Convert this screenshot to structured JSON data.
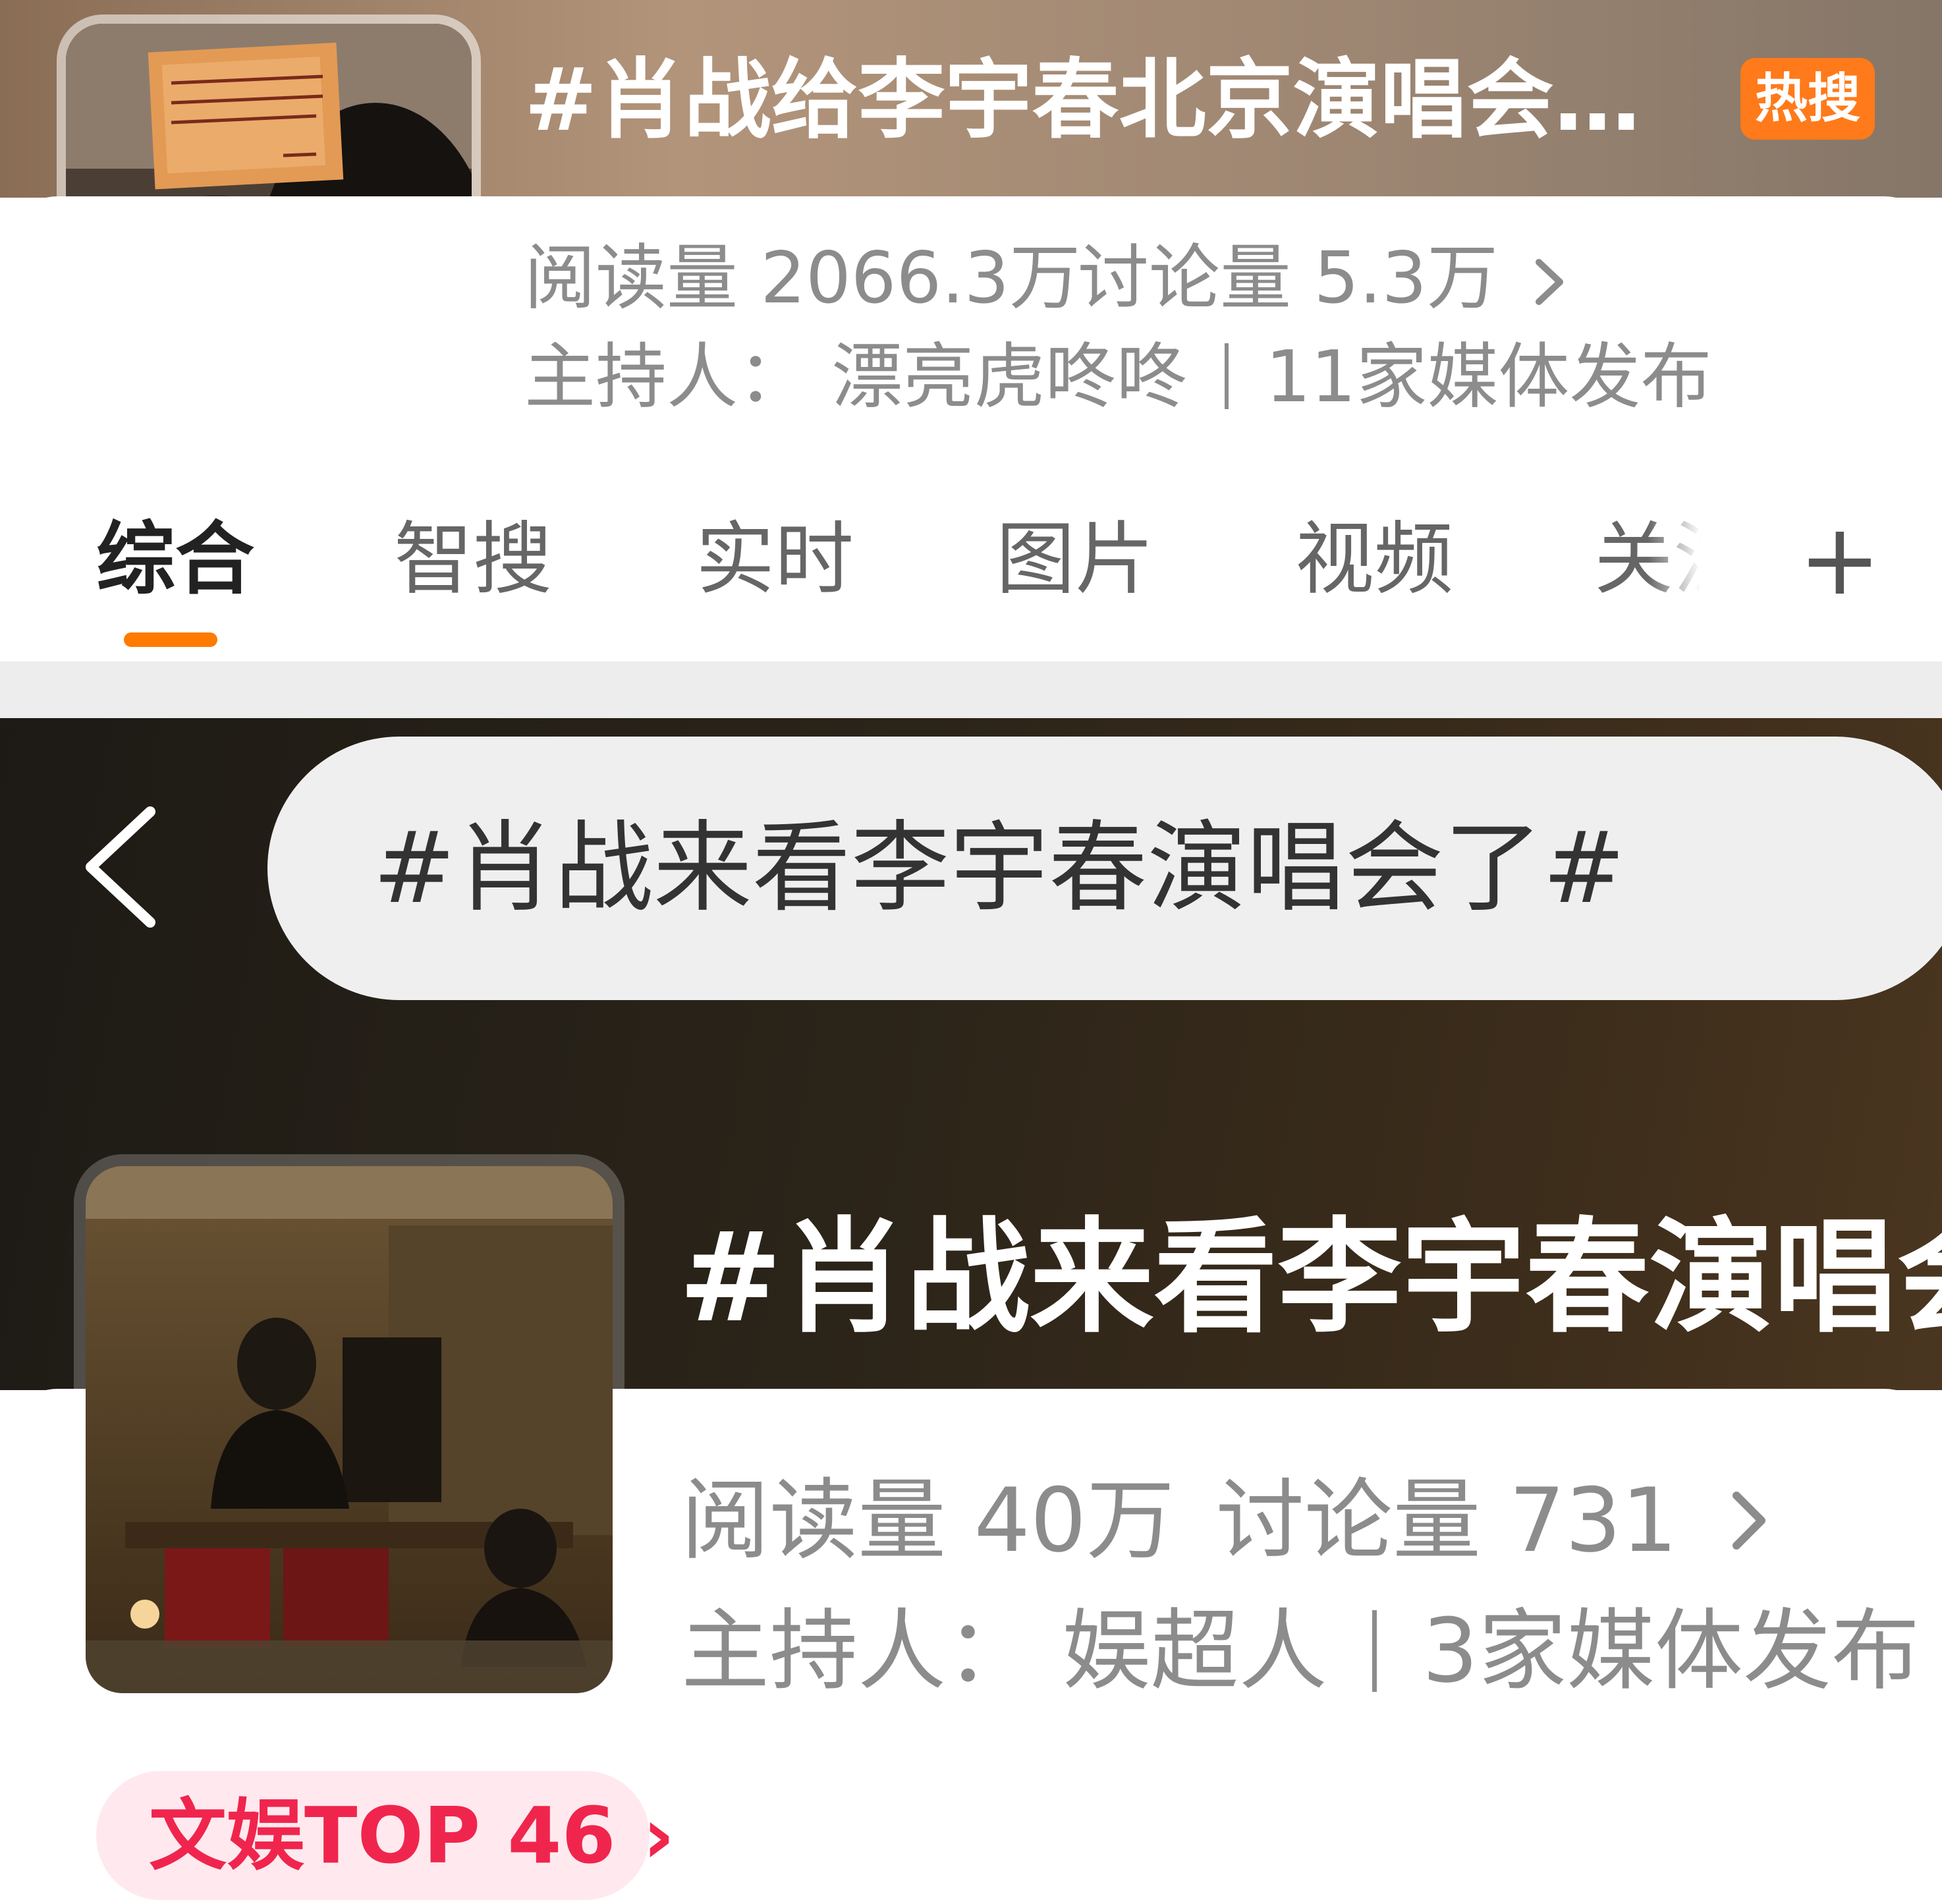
{
  "panel1": {
    "title": "#肖战给李宇春北京演唱会…",
    "hot_badge": "热搜",
    "reads_label": "阅读量",
    "reads": "2066.3万",
    "discussion_label": "讨论量",
    "discussion": "5.3万",
    "host_line": "主持人：  漂亮虎咚咚",
    "media_line": "11家媒体发布",
    "tabs": [
      {
        "label": "综合"
      },
      {
        "label": "智搜"
      },
      {
        "label": "实时"
      },
      {
        "label": "图片"
      },
      {
        "label": "视频"
      },
      {
        "label": "关注"
      }
    ],
    "add_tab": "+",
    "thumb_card_text": "祝春春 皇后与梦想 北京收官场演出顺利 春暖艳阳天，岁岁平安 肖战"
  },
  "panel2": {
    "search_query": "#肖战来看李宇春演唱会了#",
    "title": "#肖战来看李宇春演唱会",
    "reads_label": "阅读量",
    "reads": "40万",
    "discussion_label": "讨论量",
    "discussion": "731",
    "host_line": "主持人：  娱超人",
    "media_line": "3家媒体发布",
    "rank_badge": "文娱TOP 46 ›"
  },
  "colors": {
    "accent_orange": "#ff7a00",
    "hot_badge_bg": "#ff7a1a",
    "rank_text": "#f0254d",
    "rank_bg": "#ffe9ee",
    "meta_gray": "#8c8c8c"
  }
}
